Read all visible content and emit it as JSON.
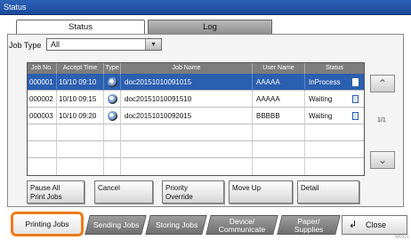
{
  "window": {
    "title": "Status"
  },
  "tabs": [
    {
      "label": "Status"
    },
    {
      "label": "Log"
    }
  ],
  "filter": {
    "label": "Job Type",
    "value": "All"
  },
  "table": {
    "columns": [
      "Job No.",
      "Accept Time",
      "Type",
      "Job Name",
      "User Name",
      "Status"
    ],
    "rows": [
      {
        "no": "000001",
        "time": "10/10 09:10",
        "name": "doc20151010091015",
        "user": "AAAAA",
        "status": "InProcess"
      },
      {
        "no": "000002",
        "time": "10/10 09:15",
        "name": "doc20151010091510",
        "user": "AAAAA",
        "status": "Waiting"
      },
      {
        "no": "000003",
        "time": "10/10 09:20",
        "name": "doc20151010092015",
        "user": "BBBBB",
        "status": "Waiting"
      }
    ]
  },
  "pager": {
    "indicator": "1/1",
    "up_icon": "chevron-up-icon",
    "down_icon": "chevron-down-icon"
  },
  "actions": {
    "pause": "Pause All\nPrint Jobs",
    "cancel": "Cancel",
    "priority": "Priority\nOverride",
    "moveup": "Move Up",
    "detail": "Detail"
  },
  "bottom_tabs": {
    "printing": "Printing Jobs",
    "sending": "Sending Jobs",
    "storing": "Storing Jobs",
    "device": "Device/\nCommunicate",
    "paper": "Paper/\nSupplies",
    "close": "Close"
  },
  "corner_code": "W0101",
  "colors": {
    "titlebar": "#1f4fa3",
    "selected_row": "#2b5fb0",
    "highlight": "#f07a1a"
  }
}
